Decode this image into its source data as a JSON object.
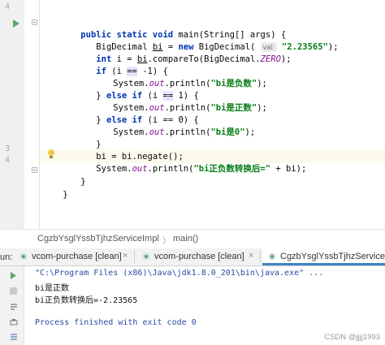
{
  "editor": {
    "line_numbers": [
      "4",
      "",
      "",
      "",
      "",
      "",
      "",
      "",
      "",
      "",
      "",
      "",
      "3",
      "4",
      "",
      "",
      "",
      "",
      ""
    ],
    "visible_line_numbers": [
      "3",
      "4"
    ],
    "code": {
      "l1_kw1": "public static void ",
      "l1_rest": "main(String[] args) {",
      "l2_a": "BigDecimal ",
      "l2_var": "bi",
      "l2_b": " = ",
      "l2_new": "new ",
      "l2_c": "BigDecimal(",
      "l2_hint": "val:",
      "l2_str": "\"2.23565\"",
      "l2_d": ");",
      "l3_int": "int ",
      "l3_a": "i = ",
      "l3_bi": "bi",
      "l3_b": ".compareTo(BigDecimal.",
      "l3_zero": "ZERO",
      "l3_c": ");",
      "l4_if": "if ",
      "l4_a": "(i ",
      "l4_op": "==",
      "l4_b": " -1) {",
      "l5_a": "System.",
      "l5_out": "out",
      "l5_b": ".println(",
      "l5_str": "\"bi是负数\"",
      "l5_c": ");",
      "l6_a": "} ",
      "l6_else": "else if ",
      "l6_b": "(i ",
      "l6_op": "==",
      "l6_c": " 1) {",
      "l7_a": "System.",
      "l7_out": "out",
      "l7_b": ".println(",
      "l7_str": "\"bi是正数\"",
      "l7_c": ");",
      "l8_a": "} ",
      "l8_else": "else if ",
      "l8_b": "(i == 0) {",
      "l9_a": "System.",
      "l9_out": "out",
      "l9_b": ".println(",
      "l9_str": "\"bi是0\"",
      "l9_c": ");",
      "l10": "}",
      "l11": "bi = bi.negate();",
      "l12_a": "System.",
      "l12_out": "out",
      "l12_b": ".println(",
      "l12_str": "\"bi正负数转换后=\"",
      "l12_c": " + bi);",
      "l13": "}",
      "l14": "}"
    }
  },
  "breadcrumb": {
    "class_name": "CgzbYsglYssbTjhzServiceImpl",
    "separator": "〉",
    "method": "main()"
  },
  "run_panel": {
    "label": "un:",
    "tabs": [
      {
        "label": "vcom-purchase [clean]",
        "close": "×"
      },
      {
        "label": "vcom-purchase [clean]",
        "close": "×"
      },
      {
        "label": "CgzbYsglYssbTjhzServiceImi",
        "close": ""
      }
    ]
  },
  "console": {
    "command": "\"C:\\Program Files (x86)\\Java\\jdk1.8.0_201\\bin\\java.exe\" ...",
    "output1": "bi是正数",
    "output2": "bi正负数转换后=-2.23565",
    "finished": "Process finished with exit code 0"
  },
  "watermark": "CSDN @jjjj1993",
  "icons": [
    "run-icon",
    "fold-icon",
    "lightbulb-icon",
    "run-config-icon",
    "close-icon",
    "rerun-icon",
    "stop-icon",
    "scroll-icon",
    "print-icon",
    "pin-icon"
  ],
  "colors": {
    "keyword": "#0033b3",
    "string": "#067d17",
    "static_field": "#871094",
    "current_line": "#fcfaed",
    "tab_underline": "#4083c9",
    "console_blue": "#2a4aa3"
  }
}
